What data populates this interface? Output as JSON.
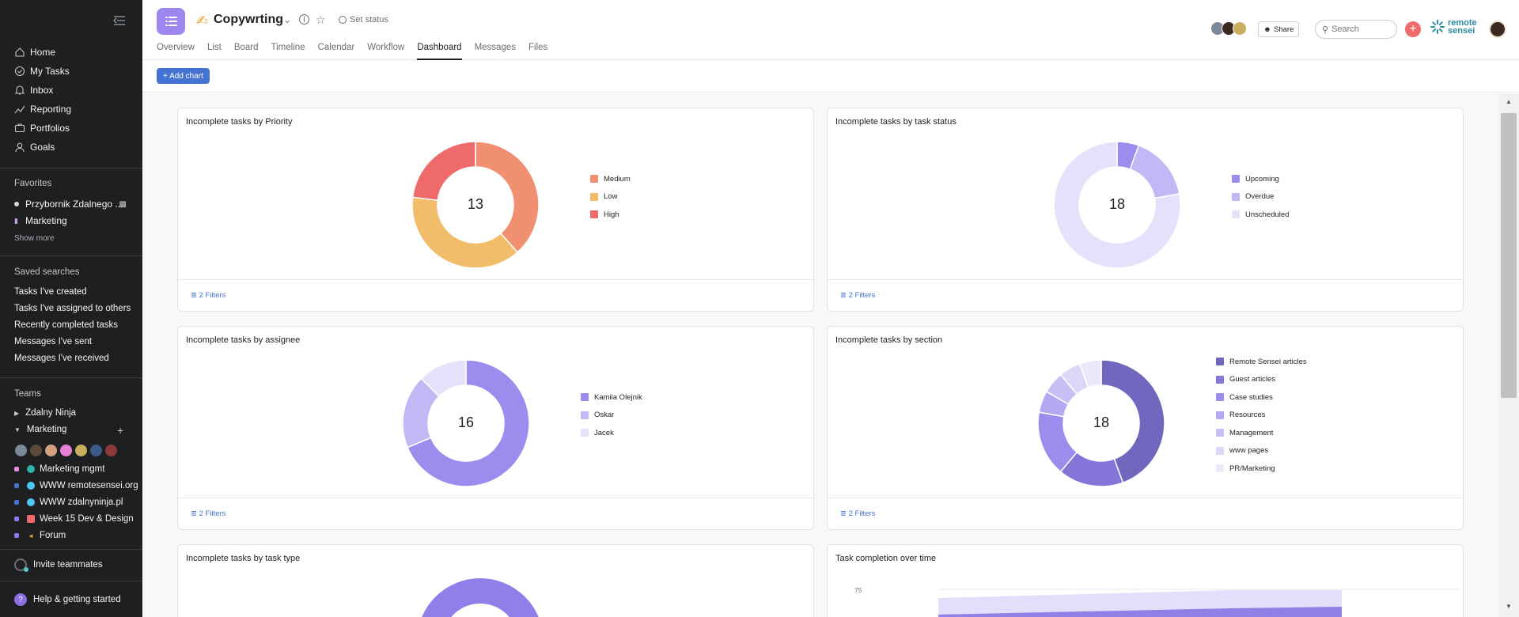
{
  "sidebar": {
    "nav": [
      {
        "label": "Home",
        "icon": "home-icon"
      },
      {
        "label": "My Tasks",
        "icon": "check-circle-icon"
      },
      {
        "label": "Inbox",
        "icon": "bell-icon"
      },
      {
        "label": "Reporting",
        "icon": "trend-icon"
      },
      {
        "label": "Portfolios",
        "icon": "folder-icon"
      },
      {
        "label": "Goals",
        "icon": "person-icon"
      }
    ],
    "favorites_heading": "Favorites",
    "favorites": [
      {
        "label": "Przybornik Zdalnego ..."
      },
      {
        "label": "Marketing"
      }
    ],
    "show_more": "Show more",
    "saved_heading": "Saved searches",
    "saved": [
      "Tasks I've created",
      "Tasks I've assigned to others",
      "Recently completed tasks",
      "Messages I've sent",
      "Messages I've received"
    ],
    "teams_heading": "Teams",
    "teams": [
      {
        "label": "Zdalny Ninja"
      },
      {
        "label": "Marketing"
      }
    ],
    "projects": [
      {
        "label": "Marketing mgmt",
        "dot": "#e88ee0",
        "icon_color": "#2bb5a8"
      },
      {
        "label": "WWW remotesensei.org",
        "dot": "#4573d2",
        "icon_color": "#4ec8f0"
      },
      {
        "label": "WWW zdalnyninja.pl",
        "dot": "#4573d2",
        "icon_color": "#4ec8f0"
      },
      {
        "label": "Week 15 Dev & Design",
        "dot": "#8b7ee8",
        "icon_color": "#f06a6a"
      },
      {
        "label": "Forum",
        "dot": "#8b7ee8",
        "icon_color": "#e8a33a"
      }
    ],
    "invite": "Invite teammates",
    "help": "Help & getting started"
  },
  "header": {
    "title": "Copywrting",
    "set_status": "Set status",
    "tabs": [
      "Overview",
      "List",
      "Board",
      "Timeline",
      "Calendar",
      "Workflow",
      "Dashboard",
      "Messages",
      "Files"
    ],
    "active_tab": "Dashboard",
    "share": "Share",
    "search_placeholder": "Search",
    "brand_line1": "remote",
    "brand_line2": "sensei"
  },
  "toolbar": {
    "add_chart": "+ Add chart"
  },
  "cards": {
    "priority": {
      "title": "Incomplete tasks by Priority",
      "filters": "2 Filters",
      "total": "13"
    },
    "status": {
      "title": "Incomplete tasks by task status",
      "filters": "2 Filters",
      "total": "18"
    },
    "assignee": {
      "title": "Incomplete tasks by assignee",
      "filters": "2 Filters",
      "total": "16"
    },
    "section": {
      "title": "Incomplete tasks by section",
      "filters": "2 Filters",
      "total": "18"
    },
    "tasktype": {
      "title": "Incomplete tasks by task type"
    },
    "completion": {
      "title": "Task completion over time",
      "y_tick": "75"
    }
  },
  "chart_data": [
    {
      "type": "pie",
      "title": "Incomplete tasks by Priority",
      "categories": [
        "Medium",
        "Low",
        "High"
      ],
      "values": [
        5,
        5,
        3
      ],
      "colors": [
        "#f09070",
        "#f2bd6a",
        "#ef6a6a"
      ]
    },
    {
      "type": "pie",
      "title": "Incomplete tasks by task status",
      "categories": [
        "Upcoming",
        "Overdue",
        "Unscheduled"
      ],
      "values": [
        1,
        3,
        14
      ],
      "colors": [
        "#9a8ded",
        "#c2b8f6",
        "#e6e1fb"
      ]
    },
    {
      "type": "pie",
      "title": "Incomplete tasks by assignee",
      "categories": [
        "Kamila Olejnik",
        "Oskar",
        "Jacek"
      ],
      "values": [
        11,
        3,
        2
      ],
      "colors": [
        "#9a8ded",
        "#c2b8f6",
        "#e6e1fb"
      ]
    },
    {
      "type": "pie",
      "title": "Incomplete tasks by section",
      "categories": [
        "Remote Sensei articles",
        "Guest articles",
        "Case studies",
        "Resources",
        "Management",
        "www pages",
        "PR/Marketing"
      ],
      "values": [
        8,
        3,
        3,
        1,
        1,
        1,
        1
      ],
      "colors": [
        "#7068bf",
        "#8376d8",
        "#9a8ded",
        "#b3a8f2",
        "#c8c0f5",
        "#dcd6f8",
        "#ebe8fb"
      ]
    }
  ]
}
